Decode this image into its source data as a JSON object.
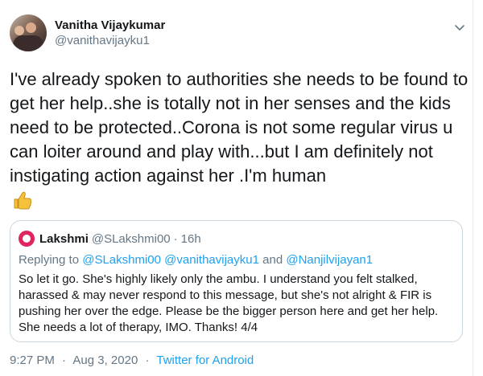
{
  "author": {
    "display_name": "Vanitha Vijaykumar",
    "handle": "@vanithavijayku1",
    "avatar_icon": "profile-photo"
  },
  "tweet": {
    "text": "I've already spoken to authorities she needs to be found to get her help..she is totally not in her senses and the kids need to be protected..Corona is not some regular virus u can loiter around and play with...but I am definitely not instigating action against her .I'm human",
    "emoji": "thumbs-up"
  },
  "quoted_tweet": {
    "display_name": "Lakshmi",
    "handle": "@SLakshmi00",
    "separator": "·",
    "time": "16h",
    "reply_prefix": "Replying to",
    "reply_mentions": [
      "@SLakshmi00",
      "@vanithavijayku1"
    ],
    "reply_and": "and",
    "reply_last_mention": "@Nanjilvijayan1",
    "text": "So let it go. She's highly likely only the ambu. I understand you felt stalked, harassed & may never respond to this message, but she's not alright & FIR is pushing her over the edge. Please be the bigger person here and get her help. She needs a lot of therapy, IMO. Thanks! 4/4"
  },
  "meta": {
    "time": "9:27 PM",
    "date": "Aug 3, 2020",
    "separator": "·",
    "source": "Twitter for Android"
  },
  "colors": {
    "link": "#1da1f2",
    "secondary_text": "#657786",
    "primary_text": "#14171a",
    "border": "#ccd6dd",
    "emoji": "#f5c33b"
  }
}
